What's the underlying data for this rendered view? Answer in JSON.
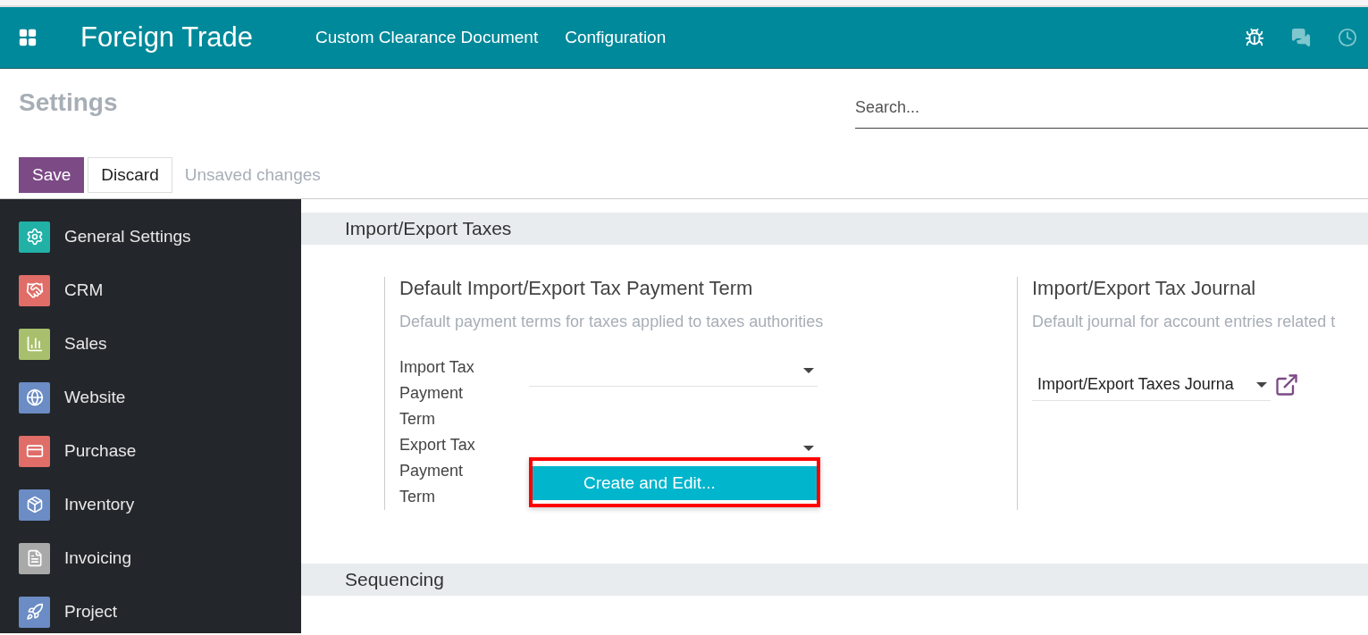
{
  "navbar": {
    "app_title": "Foreign Trade",
    "menu": [
      "Custom Clearance Document",
      "Configuration"
    ]
  },
  "control_panel": {
    "title": "Settings",
    "search": {
      "placeholder": "Search..."
    },
    "buttons": [
      {
        "label": "Save",
        "kind": "primary"
      },
      {
        "label": "Discard",
        "kind": "secondary"
      }
    ],
    "status": "Unsaved changes"
  },
  "sidebar": {
    "items": [
      {
        "label": "General Settings",
        "color": "#21b1a7"
      },
      {
        "label": "CRM",
        "color": "#e06d68"
      },
      {
        "label": "Sales",
        "color": "#a8c06d"
      },
      {
        "label": "Website",
        "color": "#6b8cc4"
      },
      {
        "label": "Purchase",
        "color": "#e06d68"
      },
      {
        "label": "Inventory",
        "color": "#6b8cc4"
      },
      {
        "label": "Invoicing",
        "color": "#a9a9a9"
      },
      {
        "label": "Project",
        "color": "#6b8cc4"
      }
    ]
  },
  "sections": [
    {
      "title": "Import/Export Taxes",
      "settings": [
        {
          "title": "Default Import/Export Tax Payment Term",
          "description": "Default payment terms for taxes applied to taxes authorities",
          "fields": [
            {
              "kind": "select",
              "label": "Import Tax Payment Term"
            },
            {
              "kind": "select",
              "label": "Export Tax Payment Term",
              "dropdown": [
                {
                  "label": "Create and Edit...",
                  "selected": true
                }
              ]
            }
          ]
        },
        {
          "title": "Import/Export Tax Journal",
          "description": "Default journal for account entries related t",
          "fields": [
            {
              "kind": "select_link",
              "value": "Import/Export Taxes Journa"
            }
          ]
        }
      ]
    },
    {
      "title": "Sequencing"
    }
  ]
}
